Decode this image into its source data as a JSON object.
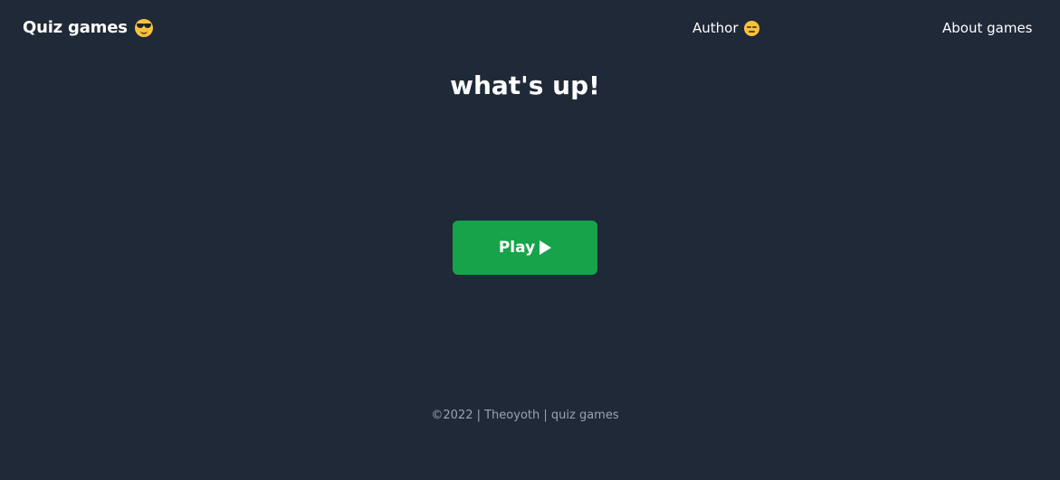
{
  "nav": {
    "brand": "Quiz games",
    "brand_icon": "cool-sunglasses-emoji",
    "author_label": "Author",
    "author_icon": "neutral-face-emoji",
    "about_label": "About games"
  },
  "main": {
    "headline": "what's up!",
    "play_label": "Play",
    "play_icon": "play-triangle"
  },
  "footer": {
    "text": "©2022 | Theoyoth | quiz games"
  },
  "colors": {
    "background": "#1f2937",
    "play_button": "#16a34a",
    "text": "#ffffff",
    "footer_text": "#9aa3b2"
  }
}
